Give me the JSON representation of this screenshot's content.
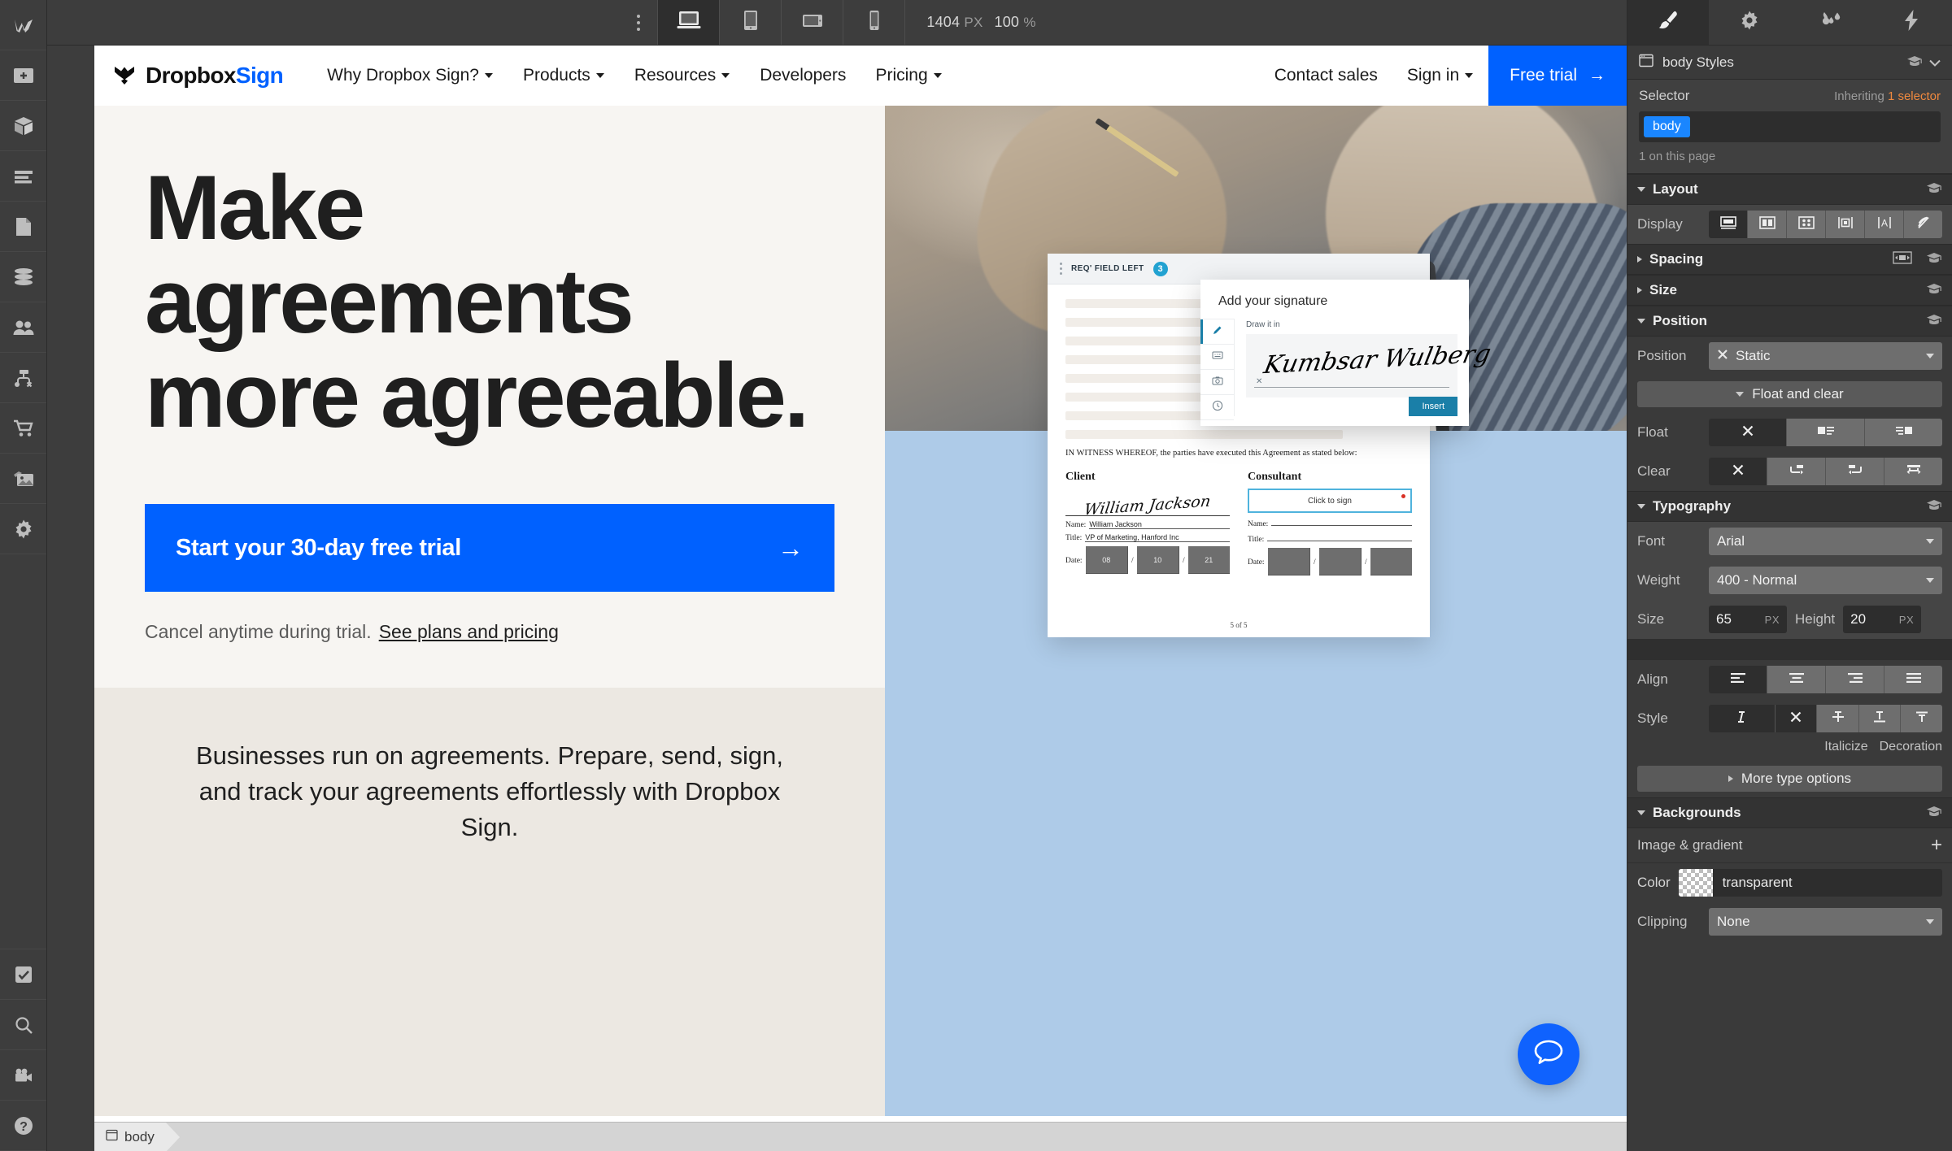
{
  "toolbar": {
    "logo": "webflow-logo",
    "kebab": "more-options",
    "devices": [
      {
        "name": "desktop",
        "icon": "desktop-icon",
        "active": true
      },
      {
        "name": "tablet",
        "icon": "tablet-icon",
        "active": false
      },
      {
        "name": "tablet-landscape",
        "icon": "tablet-landscape-icon",
        "active": false
      },
      {
        "name": "mobile",
        "icon": "mobile-icon",
        "active": false
      }
    ],
    "width_value": "1404",
    "width_unit": "PX",
    "zoom_value": "100",
    "zoom_unit": "%"
  },
  "left_rail": [
    {
      "name": "webflow-logo",
      "icon": "webflow-logo-icon"
    },
    {
      "name": "add-elements",
      "icon": "plus-panel-icon"
    },
    {
      "name": "components",
      "icon": "cube-icon"
    },
    {
      "name": "navigator",
      "icon": "layers-icon"
    },
    {
      "name": "pages",
      "icon": "page-icon"
    },
    {
      "name": "cms",
      "icon": "database-icon"
    },
    {
      "name": "users",
      "icon": "users-icon"
    },
    {
      "name": "logic",
      "icon": "flow-icon"
    },
    {
      "name": "ecommerce",
      "icon": "cart-icon"
    },
    {
      "name": "assets",
      "icon": "image-icon"
    },
    {
      "name": "settings",
      "icon": "gear-icon"
    },
    {
      "name": "audit",
      "icon": "checkbox-check-icon"
    },
    {
      "name": "search",
      "icon": "search-icon"
    },
    {
      "name": "video-tutorials",
      "icon": "video-camera-icon"
    },
    {
      "name": "help",
      "icon": "question-mark-icon"
    }
  ],
  "site": {
    "nav": {
      "brand_main": "Dropbox",
      "brand_accent": "Sign",
      "links": [
        {
          "label": "Why Dropbox Sign?",
          "has_caret": true
        },
        {
          "label": "Products",
          "has_caret": true
        },
        {
          "label": "Resources",
          "has_caret": true
        },
        {
          "label": "Developers",
          "has_caret": false
        },
        {
          "label": "Pricing",
          "has_caret": true
        }
      ],
      "contact_sales": "Contact sales",
      "sign_in": "Sign in",
      "free_trial": "Free trial",
      "free_trial_arrow": "→"
    },
    "hero": {
      "headline": "Make agreements more agreeable.",
      "cta_label": "Start your 30-day free trial",
      "cta_arrow": "→",
      "cta_sub_text": "Cancel anytime during trial.",
      "cta_sub_link": "See plans and pricing",
      "lower_paragraph": "Businesses run on agreements. Prepare, send, sign, and track your agreements effortlessly with Dropbox Sign."
    },
    "doc": {
      "bar_label": "REQ' FIELD LEFT",
      "bar_count": "3",
      "witness_text": "IN WITNESS WHEREOF, the parties have executed this Agreement as stated below:",
      "client_heading": "Client",
      "client_signature": "William Jackson",
      "client_name_label": "Name:",
      "client_name_value": "William Jackson",
      "client_title_label": "Title:",
      "client_title_value": "VP of Marketing, Hanford Inc",
      "client_date_label": "Date:",
      "client_date_mm": "08",
      "client_date_dd": "10",
      "client_date_yy": "21",
      "consultant_heading": "Consultant",
      "click_to_sign": "Click to sign",
      "consultant_name_label": "Name:",
      "consultant_title_label": "Title:",
      "consultant_date_label": "Date:",
      "page_num": "5 of 5"
    },
    "signature_modal": {
      "title": "Add your signature",
      "hint": "Draw it in",
      "drawn_signature": "Kumbsar Wulberg",
      "clear_mark": "✕",
      "insert_label": "Insert",
      "tabs": [
        {
          "name": "draw",
          "icon": "pen-icon",
          "active": true
        },
        {
          "name": "type",
          "icon": "keyboard-icon",
          "active": false
        },
        {
          "name": "upload-photo",
          "icon": "camera-icon",
          "active": false
        },
        {
          "name": "saved",
          "icon": "clock-icon",
          "active": false
        }
      ]
    },
    "chat_fab": "chat-bubble-icon",
    "breadcrumb": "body"
  },
  "right_panel": {
    "tabs": [
      {
        "name": "style",
        "icon": "paintbrush-icon",
        "active": true
      },
      {
        "name": "settings",
        "icon": "gear-icon",
        "active": false
      },
      {
        "name": "interactions",
        "icon": "water-drops-icon",
        "active": false
      },
      {
        "name": "effects",
        "icon": "lightning-bolt-icon",
        "active": false
      }
    ],
    "title": "body Styles",
    "selector": {
      "label": "Selector",
      "inheriting_prefix": "Inheriting ",
      "inheriting_count": "1 selector",
      "chip": "body",
      "note": "1 on this page"
    },
    "layout": {
      "section": "Layout",
      "display_label": "Display",
      "display_options": [
        {
          "name": "block",
          "icon": "display-block-icon",
          "active": true
        },
        {
          "name": "flex",
          "icon": "display-flex-icon",
          "active": false
        },
        {
          "name": "grid",
          "icon": "display-grid-icon",
          "active": false
        },
        {
          "name": "inline-block",
          "icon": "display-inline-block-icon",
          "active": false
        },
        {
          "name": "inline",
          "icon": "display-inline-icon",
          "active": false
        },
        {
          "name": "none",
          "icon": "display-none-icon",
          "active": false
        }
      ]
    },
    "spacing": {
      "section": "Spacing"
    },
    "size": {
      "section": "Size"
    },
    "position": {
      "section": "Position",
      "label": "Position",
      "value": "Static",
      "float_and_clear": "Float and clear",
      "float_label": "Float",
      "float_options": [
        {
          "name": "float-none",
          "icon": "x-icon",
          "active": true
        },
        {
          "name": "float-left",
          "icon": "float-left-icon",
          "active": false
        },
        {
          "name": "float-right",
          "icon": "float-right-icon",
          "active": false
        }
      ],
      "clear_label": "Clear",
      "clear_options": [
        {
          "name": "clear-none",
          "icon": "x-icon",
          "active": true
        },
        {
          "name": "clear-left",
          "icon": "clear-left-icon",
          "active": false
        },
        {
          "name": "clear-right",
          "icon": "clear-right-icon",
          "active": false
        },
        {
          "name": "clear-both",
          "icon": "clear-both-icon",
          "active": false
        }
      ]
    },
    "typography": {
      "section": "Typography",
      "font_label": "Font",
      "font_value": "Arial",
      "weight_label": "Weight",
      "weight_value": "400 - Normal",
      "size_label": "Size",
      "size_value": "65",
      "size_unit": "PX",
      "height_label": "Height",
      "height_value": "20",
      "height_unit": "PX",
      "align_label": "Align",
      "align_options": [
        {
          "name": "align-left",
          "icon": "align-left-icon",
          "active": true
        },
        {
          "name": "align-center",
          "icon": "align-center-icon",
          "active": false
        },
        {
          "name": "align-right",
          "icon": "align-right-icon",
          "active": false
        },
        {
          "name": "align-justify",
          "icon": "align-justify-icon",
          "active": false
        }
      ],
      "style_label": "Style",
      "style_options": [
        {
          "name": "italic-on",
          "icon": "italic-i-icon",
          "active": true
        },
        {
          "name": "decoration-none",
          "icon": "x-icon",
          "active": true
        },
        {
          "name": "strikethrough",
          "icon": "strikethrough-icon",
          "active": false
        },
        {
          "name": "underline",
          "icon": "underline-icon",
          "active": false
        },
        {
          "name": "overline",
          "icon": "overline-icon",
          "active": false
        }
      ],
      "italicize_label": "Italicize",
      "decoration_label": "Decoration",
      "more_type_options": "More type options"
    },
    "backgrounds": {
      "section": "Backgrounds",
      "image_gradient_label": "Image &  gradient",
      "add_icon": "+",
      "color_label": "Color",
      "color_value": "transparent",
      "clipping_label": "Clipping",
      "clipping_value": "None"
    }
  }
}
